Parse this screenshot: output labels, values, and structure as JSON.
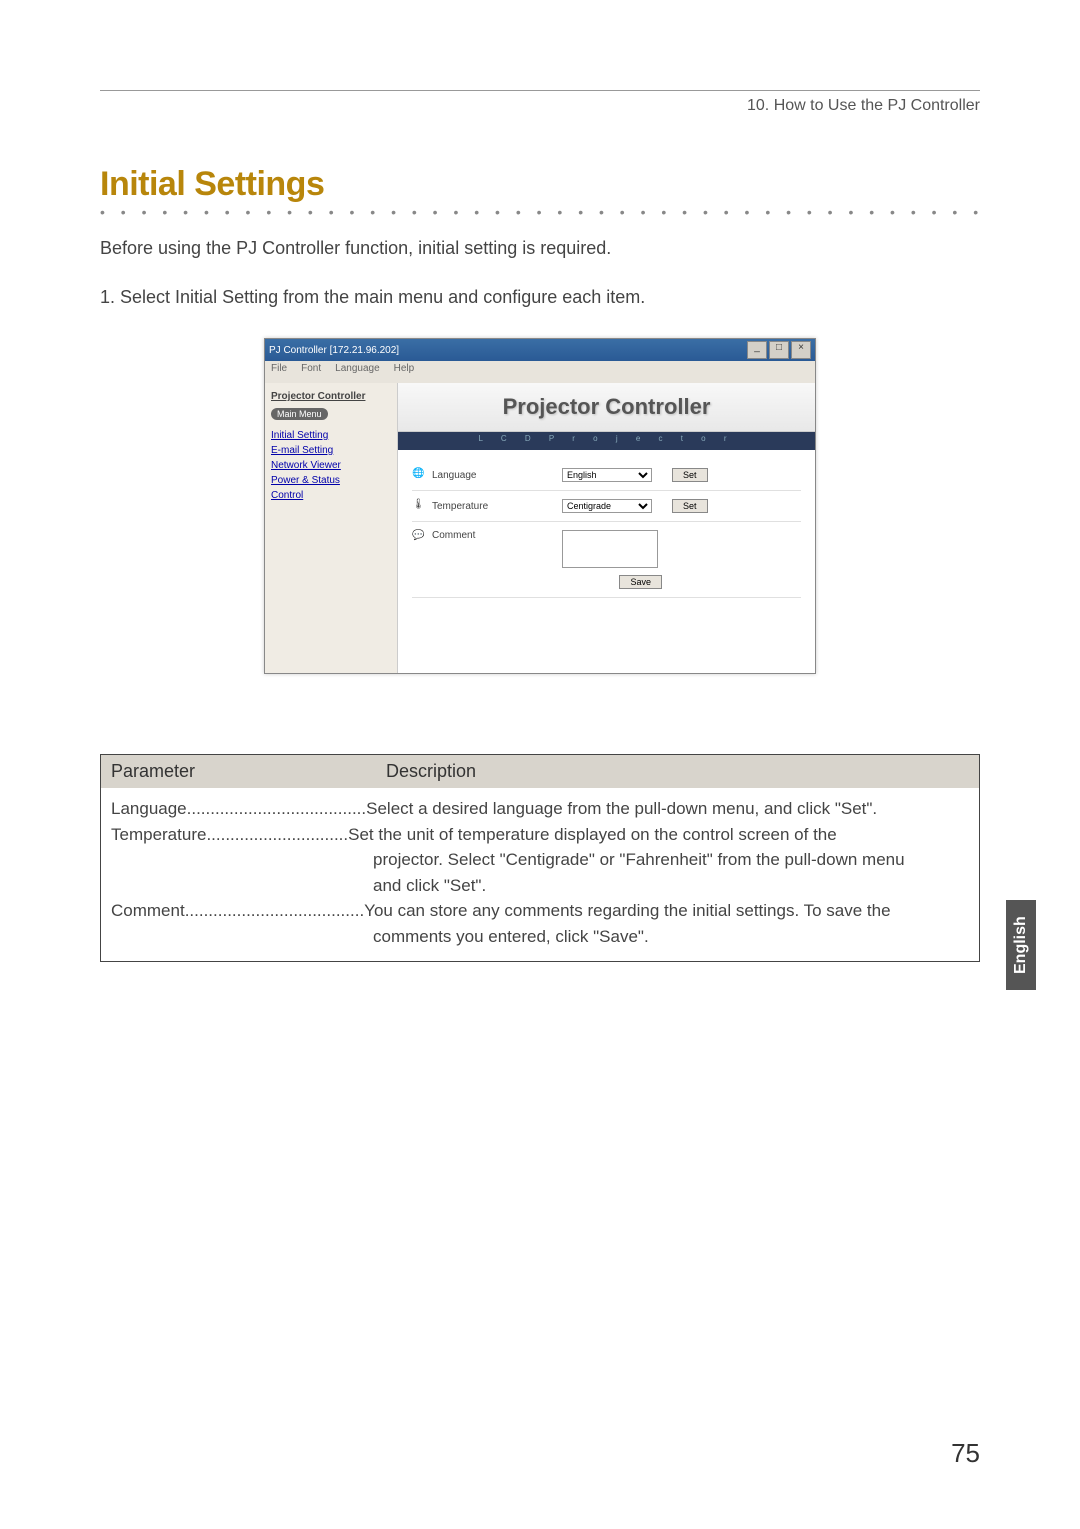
{
  "breadcrumb": "10. How to Use the PJ Controller",
  "section_title": "Initial Settings",
  "intro": "Before using the PJ Controller function, initial setting is required.",
  "step1": "1. Select Initial Setting from the main menu and configure each item.",
  "app": {
    "window_title": "PJ Controller [172.21.96.202]",
    "menu": [
      "File",
      "Font",
      "Language",
      "Help"
    ],
    "win_buttons": [
      "_",
      "□",
      "×"
    ],
    "sidebar": {
      "brand": "Projector Controller",
      "badge": "Main Menu",
      "items": [
        "Initial Setting",
        "E-mail Setting",
        "Network Viewer",
        "Power & Status",
        "Control"
      ]
    },
    "banner": "Projector Controller",
    "lcd": "L C D   P r o j e c t o r",
    "rows": {
      "language": {
        "label": "Language",
        "value": "English",
        "button": "Set"
      },
      "temperature": {
        "label": "Temperature",
        "value": "Centigrade",
        "button": "Set"
      },
      "comment": {
        "label": "Comment",
        "button": "Save"
      }
    }
  },
  "table": {
    "header": {
      "col1": "Parameter",
      "col2": "Description"
    },
    "rows": [
      {
        "param": "Language",
        "dots": "......................................",
        "desc": "Select a desired language from the pull-down menu, and click \"Set\"."
      },
      {
        "param": "Temperature",
        "dots": "..............................",
        "desc": "Set the unit of temperature displayed on the control screen of the"
      },
      {
        "cont": "projector.  Select \"Centigrade\" or \"Fahrenheit\" from the pull-down menu"
      },
      {
        "cont": "and click \"Set\"."
      },
      {
        "param": "Comment",
        "dots": "......................................",
        "desc": "You can store any comments regarding the initial settings.  To save the"
      },
      {
        "cont": "comments you entered, click \"Save\"."
      }
    ]
  },
  "side_tab": "English",
  "page_number": "75",
  "dotline": "• • • • • • • • • • • • • • • • • • • • • • • • • • • • • • • • • • • • • • • • • • • • • • • • • • • • • • • • • • • • • • • • • • • •"
}
